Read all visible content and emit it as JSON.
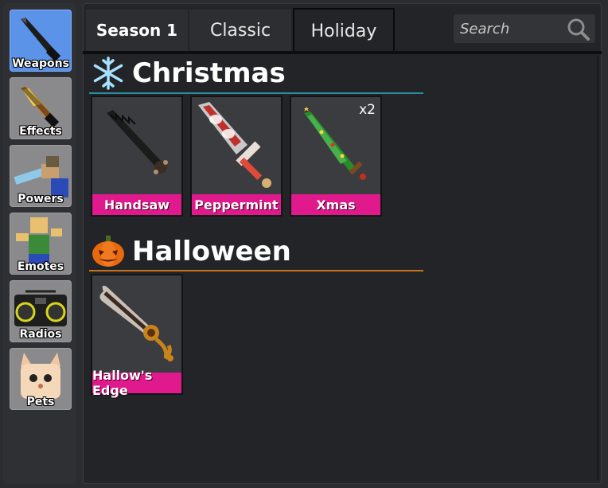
{
  "sidebar": {
    "items": [
      {
        "label": "Weapons",
        "icon": "knife-icon",
        "active": true
      },
      {
        "label": "Effects",
        "icon": "flame-knife-icon",
        "active": false
      },
      {
        "label": "Powers",
        "icon": "power-avatar-icon",
        "active": false
      },
      {
        "label": "Emotes",
        "icon": "emote-avatar-icon",
        "active": false
      },
      {
        "label": "Radios",
        "icon": "boombox-icon",
        "active": false
      },
      {
        "label": "Pets",
        "icon": "pet-cat-icon",
        "active": false
      }
    ]
  },
  "tabs": [
    {
      "label": "Season 1"
    },
    {
      "label": "Classic"
    },
    {
      "label": "Holiday"
    }
  ],
  "search": {
    "placeholder": "Search"
  },
  "sections": [
    {
      "title": "Christmas",
      "icon": "snowflake-icon",
      "accent": "#2a8aa0",
      "items": [
        {
          "name": "Handsaw",
          "quantity": ""
        },
        {
          "name": "Peppermint",
          "quantity": ""
        },
        {
          "name": "Xmas",
          "quantity": "x2"
        }
      ]
    },
    {
      "title": "Halloween",
      "icon": "pumpkin-icon",
      "accent": "#c8741a",
      "items": [
        {
          "name": "Hallow's Edge",
          "quantity": ""
        }
      ]
    }
  ],
  "colors": {
    "item_label": "#e0198c",
    "active_sidebar": "#5a93e8"
  }
}
